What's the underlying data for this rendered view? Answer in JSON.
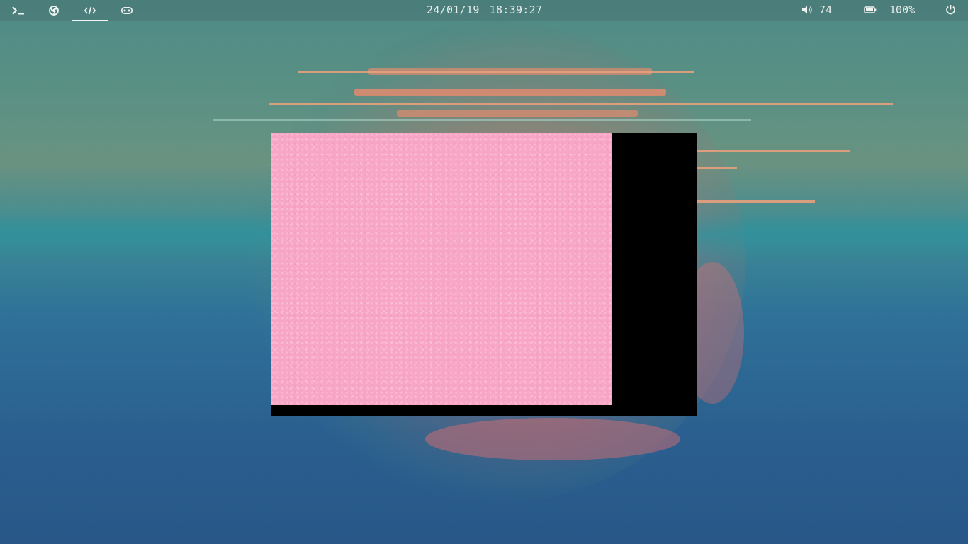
{
  "topbar": {
    "workspaces": [
      {
        "name": "terminal",
        "icon": "terminal-icon",
        "active": false
      },
      {
        "name": "browser",
        "icon": "chrome-icon",
        "active": false
      },
      {
        "name": "code",
        "icon": "code-icon",
        "active": true
      },
      {
        "name": "games",
        "icon": "gamepad-icon",
        "active": false
      }
    ],
    "date": "24/01/19",
    "time": "18:39:27",
    "volume": "74",
    "battery": "100%"
  },
  "window": {
    "content_color": "#f8a6c6",
    "frame_color": "#000000"
  },
  "colors": {
    "accent": "#f2f6f4",
    "wallpaper_teal": "#3f8c94",
    "wallpaper_blue": "#285788",
    "planet_orange": "#e08b6e"
  }
}
